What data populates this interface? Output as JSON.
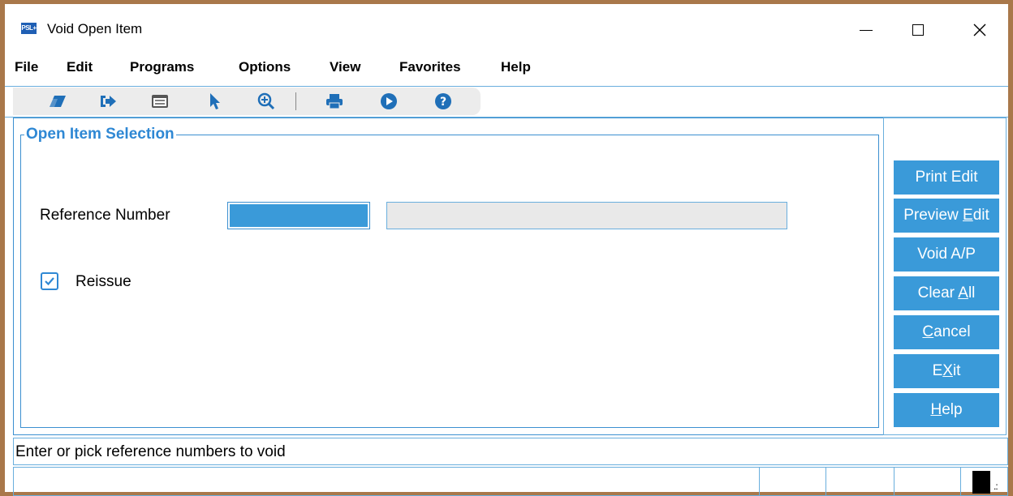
{
  "window": {
    "app_icon_text": "PSL+",
    "title": "Void Open Item",
    "controls": {
      "minimize": "minimize-icon",
      "maximize": "maximize-icon",
      "close": "close-icon"
    }
  },
  "menu": [
    "File",
    "Edit",
    "Programs",
    "Options",
    "View",
    "Favorites",
    "Help"
  ],
  "toolbar": {
    "icons": [
      "eraser-icon",
      "exit-arrow-icon",
      "list-window-icon",
      "pointer-icon",
      "zoom-in-icon",
      "print-icon",
      "play-icon",
      "help-icon"
    ]
  },
  "form": {
    "group_title": "Open Item Selection",
    "reference_label": "Reference Number",
    "reference_value": "",
    "reference_description": "",
    "reissue_label": "Reissue",
    "reissue_checked": true
  },
  "side_buttons": [
    {
      "text": "Print Edit"
    },
    {
      "pre": "Preview ",
      "u": "E",
      "post": "dit"
    },
    {
      "text": "Void A/P"
    },
    {
      "pre": "Clear ",
      "u": "A",
      "post": "ll"
    },
    {
      "pre": "",
      "u": "C",
      "post": "ancel"
    },
    {
      "pre": "E",
      "u": "X",
      "post": "it"
    },
    {
      "pre": "",
      "u": "H",
      "post": "elp"
    }
  ],
  "status": {
    "message": "Enter or pick reference numbers to void"
  },
  "colors": {
    "accent": "#3a9ad9",
    "frame": "#a9784a",
    "group_title": "#2f88d4"
  }
}
